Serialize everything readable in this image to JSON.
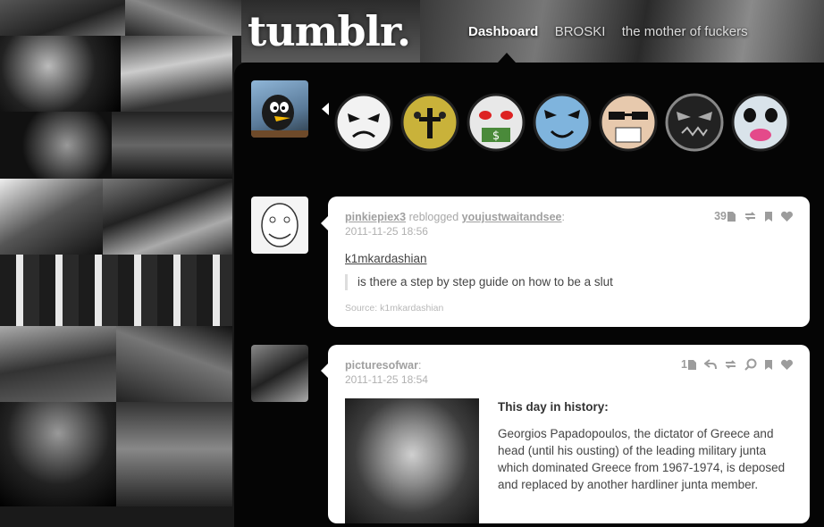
{
  "header": {
    "logo": "tumblr.",
    "nav": [
      "Dashboard",
      "BROSKI",
      "the mother of fuckers"
    ]
  },
  "masks_post": {
    "mask_icons": [
      "white-mask-icon",
      "yellow-cross-mask-icon",
      "dollar-mask-icon",
      "blue-mask-icon",
      "sunglasses-mask-icon",
      "black-mask-icon",
      "pink-mouth-mask-icon"
    ],
    "colors": [
      "#f2f2f2",
      "#c9b23a",
      "#e8e8e8",
      "#7fb4dd",
      "#e7c9ad",
      "#222222",
      "#d9e3ea"
    ]
  },
  "post1": {
    "user": "pinkiepiex3",
    "action": "reblogged",
    "reblogged_from": "youjustwaitandsee",
    "date": "2011-11-25 18:56",
    "notes": "39",
    "quote_user": "k1mkardashian",
    "quote_text": "is there a step by step guide on how to be a slut",
    "source": "Source: k1mkardashian"
  },
  "post2": {
    "user": "picturesofwar",
    "date": "2011-11-25 18:54",
    "notes": "1",
    "title": "This day in history:",
    "body": "Georgios Papadopoulos, the dictator of Greece and head (until his ousting) of the leading military junta which dominated Greece from 1967-1974, is deposed and replaced by another hardliner junta member."
  }
}
